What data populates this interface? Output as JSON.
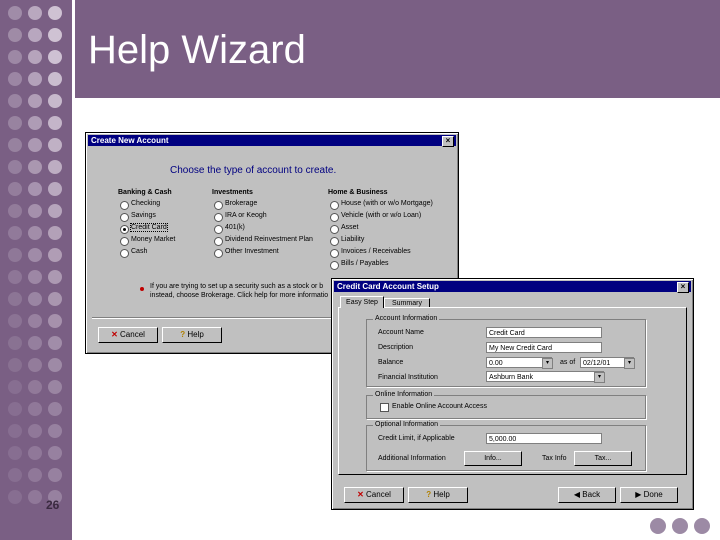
{
  "slide": {
    "title": "Help Wizard",
    "page_number": "26"
  },
  "create_dialog": {
    "title": "Create New Account",
    "heading": "Choose the type of account to create.",
    "columns": [
      {
        "header": "Banking & Cash",
        "options": [
          "Checking",
          "Savings",
          "Credit Card",
          "Money Market",
          "Cash"
        ]
      },
      {
        "header": "Investments",
        "options": [
          "Brokerage",
          "IRA or Keogh",
          "401(k)",
          "Dividend Reinvestment Plan",
          "Other Investment"
        ]
      },
      {
        "header": "Home & Business",
        "options": [
          "House (with or w/o Mortgage)",
          "Vehicle (with or w/o Loan)",
          "Asset",
          "Liability",
          "Invoices / Receivables",
          "Bills / Payables"
        ]
      }
    ],
    "selected": "Credit Card",
    "note_line1": "If you are trying to set up a security such as a stock or b",
    "note_line2": "instead, choose Brokerage. Click help for more informatio",
    "cancel_label": "Cancel",
    "help_label": "Help"
  },
  "setup_dialog": {
    "title": "Credit Card Account Setup",
    "tabs": [
      "Easy Step",
      "Summary"
    ],
    "account_info_label": "Account Information",
    "fields": {
      "account_name_label": "Account Name",
      "account_name_value": "Credit Card",
      "description_label": "Description",
      "description_value": "My New Credit Card",
      "balance_label": "Balance",
      "balance_value": "0.00",
      "as_of_label": "as of",
      "as_of_value": "02/12/01",
      "institution_label": "Financial Institution",
      "institution_value": "Ashburn Bank"
    },
    "online_label": "Online Information",
    "online_checkbox_label": "Enable Online Account Access",
    "optional_label": "Optional Information",
    "credit_limit_label": "Credit Limit, if Applicable",
    "credit_limit_value": "5,000.00",
    "additional_info_label": "Additional Information",
    "info_button": "Info...",
    "tax_label": "Tax Info",
    "tax_button": "Tax...",
    "cancel_label": "Cancel",
    "help_label": "Help",
    "back_label": "Back",
    "done_label": "Done"
  },
  "colors": {
    "frame": "#7a5f84",
    "titlebar": "#000080",
    "dialog": "#c0c0c0",
    "heading": "#000080"
  }
}
